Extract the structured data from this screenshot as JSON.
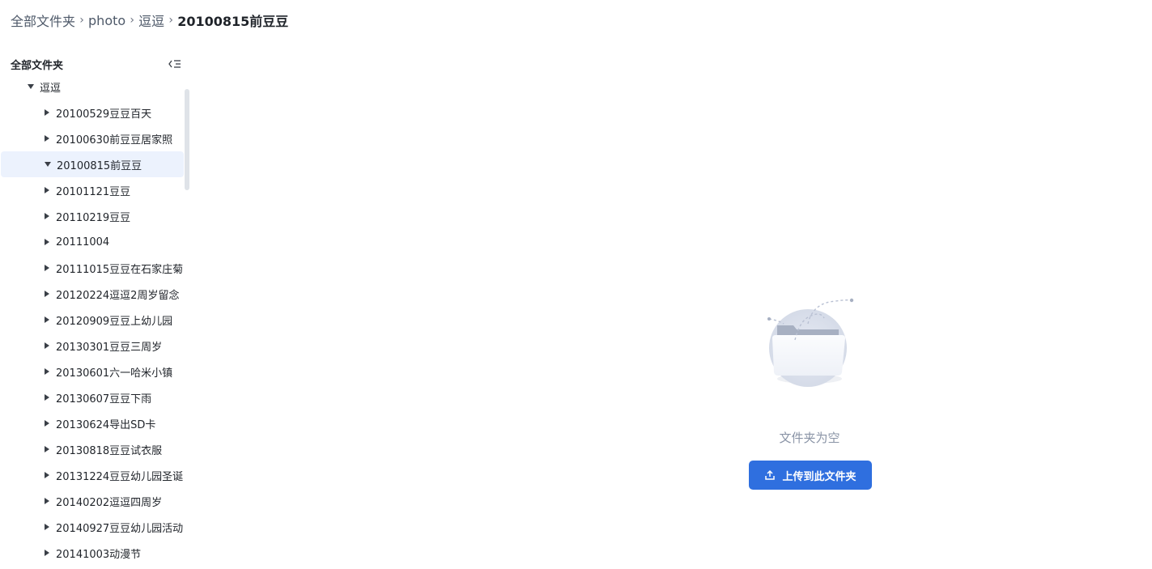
{
  "breadcrumb": {
    "items": [
      "全部文件夹",
      "photo",
      "逗逗",
      "20100815前豆豆"
    ],
    "separator": "›"
  },
  "sidebar": {
    "title": "全部文件夹",
    "collapse_icon": "collapse-list-icon",
    "root": {
      "label": "逗逗",
      "expanded": true
    },
    "children": [
      {
        "label": "20100529豆豆百天",
        "expanded": false
      },
      {
        "label": "20100630前豆豆居家照",
        "expanded": false
      },
      {
        "label": "20100815前豆豆",
        "expanded": true,
        "active": true
      },
      {
        "label": "20101121豆豆",
        "expanded": false
      },
      {
        "label": "20110219豆豆",
        "expanded": false
      },
      {
        "label": "20111004",
        "expanded": false
      },
      {
        "label": "20111015豆豆在石家庄菊",
        "expanded": false
      },
      {
        "label": "20120224逗逗2周岁留念",
        "expanded": false
      },
      {
        "label": "20120909豆豆上幼儿园",
        "expanded": false
      },
      {
        "label": "20130301豆豆三周岁",
        "expanded": false
      },
      {
        "label": "20130601六一哈米小镇",
        "expanded": false
      },
      {
        "label": "20130607豆豆下雨",
        "expanded": false
      },
      {
        "label": "20130624导出SD卡",
        "expanded": false
      },
      {
        "label": "20130818豆豆试衣服",
        "expanded": false
      },
      {
        "label": "20131224豆豆幼儿园圣诞",
        "expanded": false
      },
      {
        "label": "20140202逗逗四周岁",
        "expanded": false
      },
      {
        "label": "20140927豆豆幼儿园活动",
        "expanded": false
      },
      {
        "label": "20141003动漫节",
        "expanded": false
      }
    ]
  },
  "main": {
    "empty_text": "文件夹为空",
    "upload_label": "上传到此文件夹",
    "upload_icon": "upload-icon",
    "illustration_icon": "empty-folder-icon"
  },
  "colors": {
    "accent": "#2f6fdf",
    "active_row": "#ecf2fd",
    "muted_text": "#8a94a6"
  }
}
